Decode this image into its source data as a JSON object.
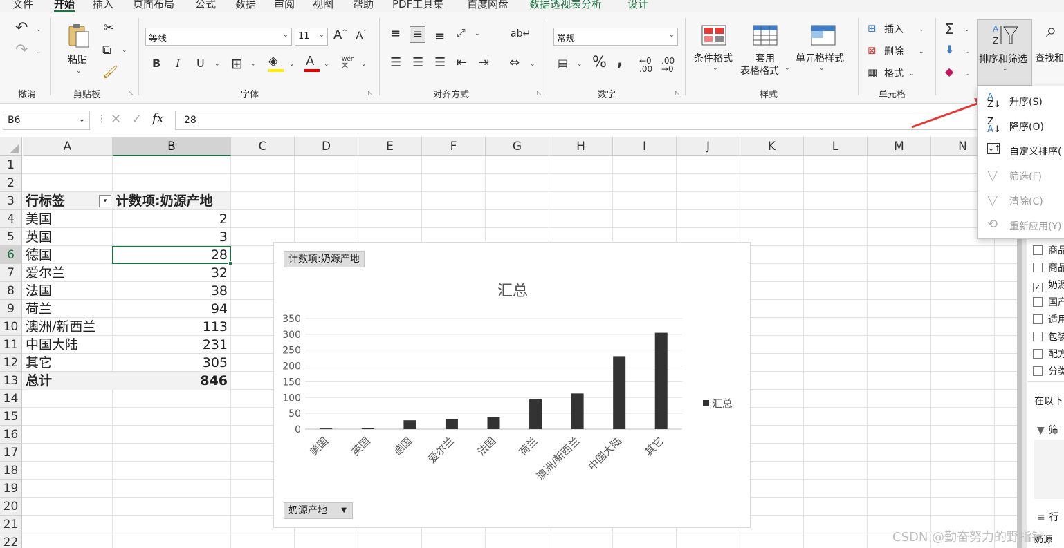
{
  "tabs": [
    "文件",
    "开始",
    "插入",
    "页面布局",
    "公式",
    "数据",
    "审阅",
    "视图",
    "帮助",
    "PDF工具集",
    "百度网盘",
    "数据透视表分析",
    "设计"
  ],
  "ribbon": {
    "undo_group": "撤消",
    "clipboard_group": "剪贴板",
    "paste_label": "粘贴",
    "font_group": "字体",
    "font_name": "等线",
    "font_size": "11",
    "phonetic_label": "wén",
    "alignment_group": "对齐方式",
    "number_group": "数字",
    "number_format": "常规",
    "styles_group": "样式",
    "cond_format": "条件格式",
    "table_format_1": "套用",
    "table_format_2": "表格格式",
    "cell_styles": "单元格样式",
    "cells_group": "单元格",
    "insert": "插入",
    "delete": "删除",
    "format": "格式",
    "sort_filter": "排序和筛选",
    "find_select": "查找和"
  },
  "formula_bar": {
    "name_box": "B6",
    "fx": "fx",
    "value": "28"
  },
  "columns": [
    "A",
    "B",
    "C",
    "D",
    "E",
    "F",
    "G",
    "H",
    "I",
    "J",
    "K",
    "L",
    "M",
    "N"
  ],
  "rows": [
    "1",
    "2",
    "3",
    "4",
    "5",
    "6",
    "7",
    "8",
    "9",
    "10",
    "11",
    "12",
    "13",
    "14",
    "15",
    "16",
    "17",
    "18",
    "19",
    "20",
    "21",
    "22"
  ],
  "pivot": {
    "row_label_header": "行标签",
    "value_header": "计数项:奶源产地",
    "rows": [
      {
        "label": "美国",
        "value": "2"
      },
      {
        "label": "英国",
        "value": "3"
      },
      {
        "label": "德国",
        "value": "28"
      },
      {
        "label": "爱尔兰",
        "value": "32"
      },
      {
        "label": "法国",
        "value": "38"
      },
      {
        "label": "荷兰",
        "value": "94"
      },
      {
        "label": "澳洲/新西兰",
        "value": "113"
      },
      {
        "label": "中国大陆",
        "value": "231"
      },
      {
        "label": "其它",
        "value": "305"
      }
    ],
    "total_label": "总计",
    "total_value": "846"
  },
  "chart_data": {
    "type": "bar",
    "title": "汇总",
    "categories": [
      "美国",
      "英国",
      "德国",
      "爱尔兰",
      "法国",
      "荷兰",
      "澳洲/新西兰",
      "中国大陆",
      "其它"
    ],
    "series": [
      {
        "name": "汇总",
        "values": [
          2,
          3,
          28,
          32,
          38,
          94,
          113,
          231,
          305
        ]
      }
    ],
    "ylim": [
      0,
      350
    ],
    "yticks": [
      0,
      50,
      100,
      150,
      200,
      250,
      300,
      350
    ],
    "grid": true,
    "legend": "right",
    "value_field_button": "计数项:奶源产地",
    "axis_field_button": "奶源产地",
    "bar_color": "#333333"
  },
  "menu": {
    "items": [
      {
        "label": "升序(S)",
        "icon": "sort-ascending-icon",
        "disabled": false
      },
      {
        "label": "降序(O)",
        "icon": "sort-descending-icon",
        "disabled": false
      },
      {
        "label": "自定义排序(",
        "icon": "custom-sort-icon",
        "disabled": false
      },
      {
        "label": "筛选(F)",
        "icon": "filter-icon",
        "disabled": true
      },
      {
        "label": "清除(C)",
        "icon": "clear-filter-icon",
        "disabled": true
      },
      {
        "label": "重新应用(Y)",
        "icon": "reapply-icon",
        "disabled": true
      }
    ]
  },
  "pane": {
    "fields": [
      {
        "label": "商品",
        "checked": false
      },
      {
        "label": "商品",
        "checked": false
      },
      {
        "label": "奶源",
        "checked": true
      },
      {
        "label": "国产",
        "checked": false
      },
      {
        "label": "适用",
        "checked": false
      },
      {
        "label": "包装",
        "checked": false
      },
      {
        "label": "配方",
        "checked": false
      },
      {
        "label": "分类",
        "checked": false
      }
    ],
    "drag_hint": "在以下",
    "filter_label": "筛",
    "rows_label": "行",
    "rows_item": "奶源"
  },
  "watermark": "CSDN @勤奋努力的野指针",
  "colors": {
    "accent": "#217346",
    "arrow": "#e53935"
  }
}
